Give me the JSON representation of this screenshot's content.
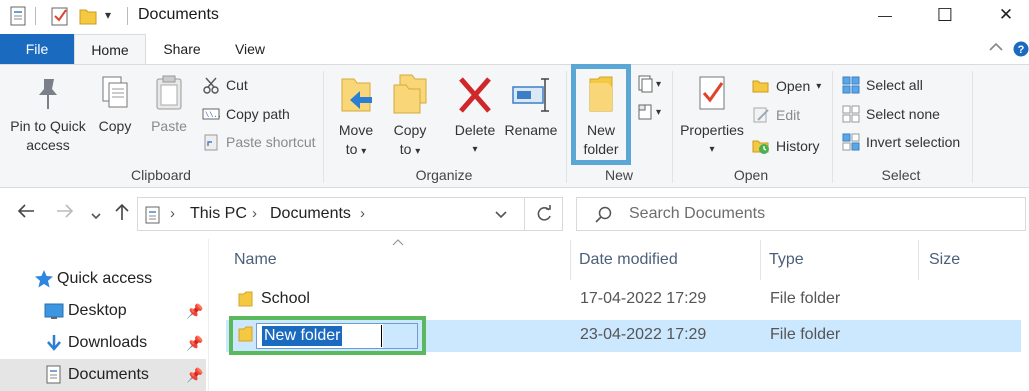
{
  "window": {
    "title": "Documents",
    "minimize_glyph": "—",
    "maximize_glyph": "☐",
    "close_glyph": "✕"
  },
  "tabs": [
    {
      "label": "File"
    },
    {
      "label": "Home"
    },
    {
      "label": "Share"
    },
    {
      "label": "View"
    }
  ],
  "ribbon": {
    "clipboard": {
      "label": "Clipboard",
      "pin_line1": "Pin to Quick",
      "pin_line2": "access",
      "copy": "Copy",
      "paste": "Paste",
      "cut": "Cut",
      "copy_path": "Copy path",
      "paste_shortcut": "Paste shortcut"
    },
    "organize": {
      "label": "Organize",
      "move_line1": "Move",
      "move_line2": "to",
      "copy_line1": "Copy",
      "copy_line2": "to",
      "delete": "Delete",
      "rename": "Rename"
    },
    "new": {
      "label": "New",
      "new_folder_line1": "New",
      "new_folder_line2": "folder"
    },
    "open": {
      "label": "Open",
      "properties": "Properties",
      "open": "Open",
      "edit": "Edit",
      "history": "History"
    },
    "select": {
      "label": "Select",
      "select_all": "Select all",
      "select_none": "Select none",
      "invert_selection": "Invert selection"
    }
  },
  "address": {
    "crumbs": [
      "This PC",
      "Documents"
    ],
    "search_placeholder": "Search Documents"
  },
  "nav": {
    "items": [
      {
        "label": "Quick access",
        "icon": "star-icon"
      },
      {
        "label": "Desktop",
        "icon": "desktop-icon"
      },
      {
        "label": "Downloads",
        "icon": "download-icon"
      },
      {
        "label": "Documents",
        "icon": "documents-icon"
      }
    ]
  },
  "list": {
    "columns": {
      "name": "Name",
      "date": "Date modified",
      "type": "Type",
      "size": "Size"
    },
    "rows": [
      {
        "name": "School",
        "date": "17-04-2022 17:29",
        "type": "File folder"
      },
      {
        "name": "New folder",
        "date": "23-04-2022 17:29",
        "type": "File folder"
      }
    ]
  },
  "colors": {
    "accent": "#1a6ac0",
    "selection": "#cce8ff",
    "highlight_blue": "#5aa7d6",
    "highlight_green": "#5cb85c",
    "folder": "#f5c842"
  }
}
